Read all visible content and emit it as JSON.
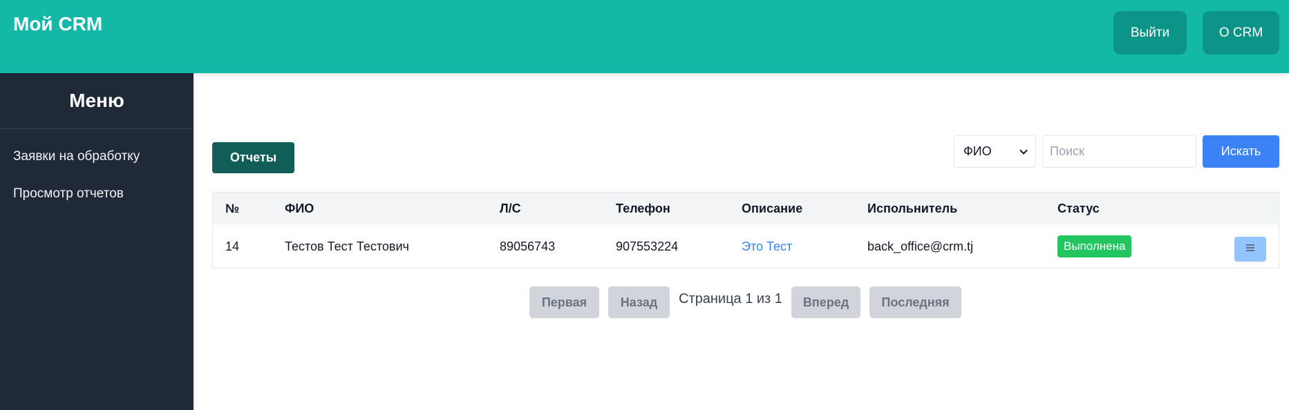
{
  "header": {
    "brand": "Мой CRM",
    "logout_label": "Выйти",
    "about_label": "О CRM",
    "accent_color": "#14b8a6"
  },
  "sidebar": {
    "title": "Меню",
    "items": [
      {
        "label": "Заявки на обработку"
      },
      {
        "label": "Просмотр отчетов"
      }
    ]
  },
  "toolbar": {
    "reports_label": "Отчеты",
    "filter_selected": "ФИО",
    "search_placeholder": "Поиск",
    "search_value": "",
    "search_button": "Искать"
  },
  "table": {
    "columns": [
      "№",
      "ФИО",
      "Л/С",
      "Телефон",
      "Описание",
      "Испольнитель",
      "Статус"
    ],
    "rows": [
      {
        "num": "14",
        "fio": "Тестов Тест Тестович",
        "account": "89056743",
        "phone": "907553224",
        "description": "Это Тест",
        "executor": "back_office@crm.tj",
        "status": "Выполнена",
        "status_color": "#22c55e",
        "action_icon": "hamburger-menu-icon"
      }
    ]
  },
  "pagination": {
    "first": "Первая",
    "back": "Назад",
    "info": "Страница 1 из 1",
    "next": "Вперед",
    "last": "Последняя"
  }
}
